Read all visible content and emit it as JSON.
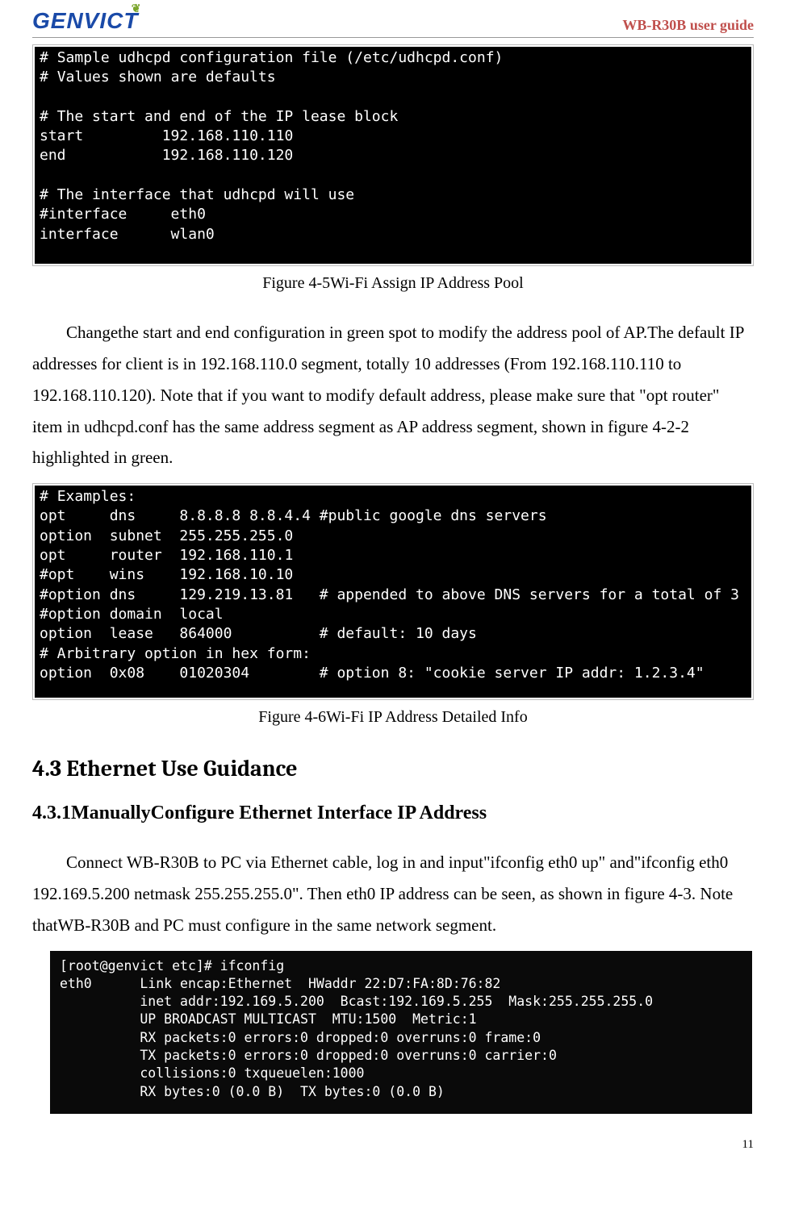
{
  "header": {
    "logo_text": "GENVICT",
    "guide_title": "WB-R30B user guide"
  },
  "terminal1": {
    "line1_a": "# ",
    "line1_b": "Sample udhcpd configuration file (/etc/udhcpd.conf)",
    "line2_a": "# ",
    "line2_b": "Values shown are defaults",
    "blank1": "",
    "line3": "# The start and end of the IP lease block",
    "line4_hl": "s",
    "line4_rest": "tart         192.168.110.110",
    "line5": "end           192.168.110.120",
    "blank2": "",
    "line6": "# The interface that udhcpd will use",
    "line7": "#interface     eth0",
    "line8": "interface      wlan0"
  },
  "caption1": "Figure 4-5Wi-Fi Assign IP Address Pool",
  "para1": "Changethe start and end configuration in green spot to modify the address pool of AP.The default IP addresses for client is in 192.168.110.0 segment, totally 10 addresses (From 192.168.110.110 to 192.168.110.120). Note that if you want to modify default address, please make sure that \"opt router\" item in udhcpd.conf has the same address segment as AP address segment, shown in figure 4-2-2 highlighted in green.",
  "terminal2": {
    "l1_a": "# ",
    "l1_b": "Examples:",
    "l2": "opt     dns     8.8.8.8 8.8.4.4 ",
    "l2_c": "#public google dns servers",
    "l3": "option  subnet  255.255.255.0",
    "l4_hl": "o",
    "l4_rest": "pt     router  192.168.110.1",
    "l5": "#opt    wins    192.168.10.10",
    "l6": "#option dns     129.219.13.81   # appended to above DNS servers for a total of 3",
    "l7": "#option domain  local",
    "l8": "option  lease   864000          # default: 10 days",
    "l9": "# Arbitrary option in hex form:",
    "l10": "option  0x08    01020304        # option 8: \"cookie server IP addr: 1.2.3.4\""
  },
  "caption2": "Figure 4-6Wi-Fi IP Address Detailed Info",
  "section": "4.3 Ethernet Use Guidance",
  "subsection": "4.3.1ManuallyConfigure Ethernet Interface IP Address",
  "para2": "Connect WB-R30B to PC via Ethernet cable, log in and input\"ifconfig eth0 up\" and\"ifconfig eth0 192.169.5.200 netmask 255.255.255.0\". Then eth0 IP address can be seen, as shown in figure 4-3. Note thatWB-R30B and PC must configure in the same network segment.",
  "terminal3": {
    "l1": "[root@genvict etc]# ifconfig",
    "l2": "eth0      Link encap:Ethernet  HWaddr 22:D7:FA:8D:76:82",
    "l3": "          inet addr:192.169.5.200  Bcast:192.169.5.255  Mask:255.255.255.0",
    "l4": "          UP BROADCAST MULTICAST  MTU:1500  Metric:1",
    "l5": "          RX packets:0 errors:0 dropped:0 overruns:0 frame:0",
    "l6": "          TX packets:0 errors:0 dropped:0 overruns:0 carrier:0",
    "l7": "          collisions:0 txqueuelen:1000",
    "l8": "          RX bytes:0 (0.0 B)  TX bytes:0 (0.0 B)"
  },
  "page_number": "11"
}
